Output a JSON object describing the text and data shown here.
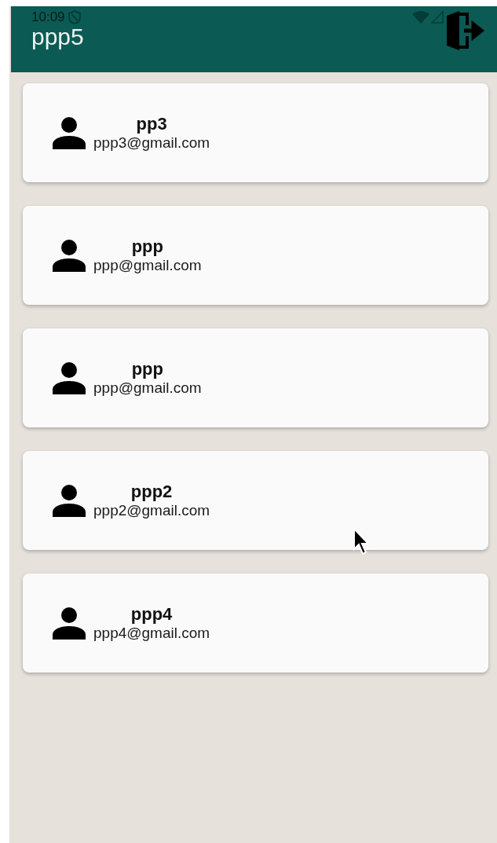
{
  "status_bar": {
    "time": "10:09"
  },
  "app_bar": {
    "title": "ppp5"
  },
  "users": [
    {
      "name": "pp3",
      "email": "ppp3@gmail.com"
    },
    {
      "name": "ppp",
      "email": "ppp@gmail.com"
    },
    {
      "name": "ppp",
      "email": "ppp@gmail.com"
    },
    {
      "name": "ppp2",
      "email": "ppp2@gmail.com"
    },
    {
      "name": "ppp4",
      "email": "ppp4@gmail.com"
    }
  ]
}
